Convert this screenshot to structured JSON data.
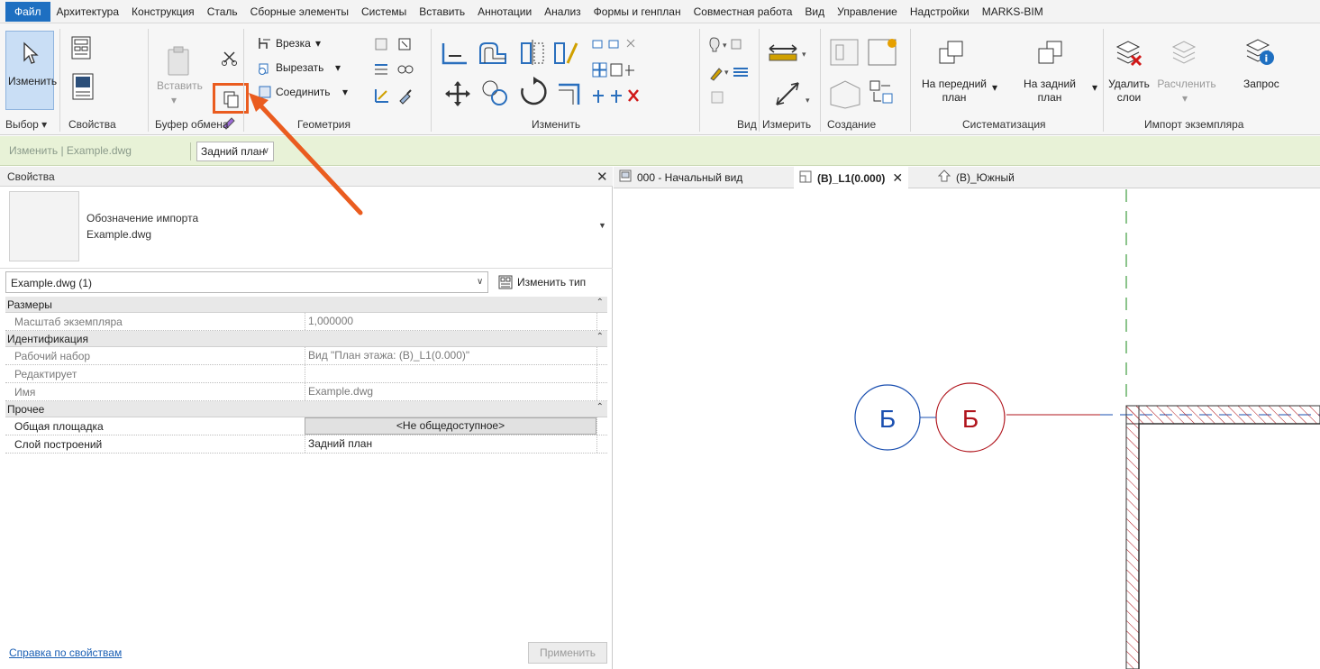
{
  "menu": [
    "Файл",
    "Архитектура",
    "Конструкция",
    "Сталь",
    "Сборные элементы",
    "Системы",
    "Вставить",
    "Аннотации",
    "Анализ",
    "Формы и генплан",
    "Совместная работа",
    "Вид",
    "Управление",
    "Надстройки",
    "MARKS-BIM"
  ],
  "ribbon": {
    "modify_label": "Изменить",
    "paste_label": "Вставить",
    "cope_label": "Врезка",
    "cut_label": "Вырезать",
    "join_label": "Соединить",
    "front_label_1": "На передний",
    "front_label_2": "план",
    "back_label_1": "На задний",
    "back_label_2": "план",
    "delete_layers_1": "Удалить",
    "delete_layers_2": "слои",
    "explode_label": "Расчленить",
    "query_label": "Запрос",
    "groups": {
      "select": "Выбор ▾",
      "properties": "Свойства",
      "clipboard": "Буфер обмена",
      "geometry": "Геометрия",
      "modify": "Изменить",
      "view": "Вид",
      "measure": "Измерить",
      "create": "Создание",
      "arrange": "Систематизация",
      "import_instance": "Импорт экземпляра"
    }
  },
  "context": {
    "title": "Изменить | Example.dwg",
    "dropdown_value": "Задний план"
  },
  "properties": {
    "title": "Свойства",
    "type_line1": "Обозначение импорта",
    "type_line2": "Example.dwg",
    "instance_selector": "Example.dwg (1)",
    "edit_type_label": "Изменить тип",
    "sections": [
      {
        "title": "Размеры",
        "rows": [
          {
            "key": "Масштаб экземпляра",
            "value": "1,000000"
          }
        ]
      },
      {
        "title": "Идентификация",
        "rows": [
          {
            "key": "Рабочий набор",
            "value": "Вид \"План этажа: (В)_L1(0.000)\""
          },
          {
            "key": "Редактирует",
            "value": ""
          },
          {
            "key": "Имя",
            "value": "Example.dwg"
          }
        ]
      },
      {
        "title": "Прочее",
        "rows": [
          {
            "key": "Общая площадка",
            "value": "<Не общедоступное>"
          },
          {
            "key": "Слой построений",
            "value": "Задний план"
          }
        ]
      }
    ],
    "help_link": "Справка по свойствам",
    "apply_label": "Применить"
  },
  "tabs": [
    {
      "label": "000 - Начальный вид"
    },
    {
      "label": "(В)_L1(0.000)",
      "close": "✕"
    },
    {
      "label": "(В)_Южный"
    }
  ],
  "canvas": {
    "grid_blue_label": "Б",
    "grid_red_label": "Б"
  },
  "colors": {
    "file_menu": "#1e6fc1",
    "context_bar": "#e8f2d7",
    "highlight": "#ea5c1f",
    "grid_blue": "#1a4fb0",
    "grid_red": "#b0141c",
    "grid_green": "#1a8a1a"
  },
  "icons": [
    "cursor-icon",
    "properties-icon",
    "paste-icon",
    "cut-scissors-icon",
    "copy-icon",
    "match-properties-icon",
    "cope-icon",
    "move-icon",
    "rotate-icon",
    "mirror-icon",
    "delete-icon",
    "dimension-icon",
    "measure-icon",
    "bring-to-front-icon",
    "send-to-back-icon",
    "delete-layers-icon",
    "explode-icon",
    "query-icon"
  ]
}
